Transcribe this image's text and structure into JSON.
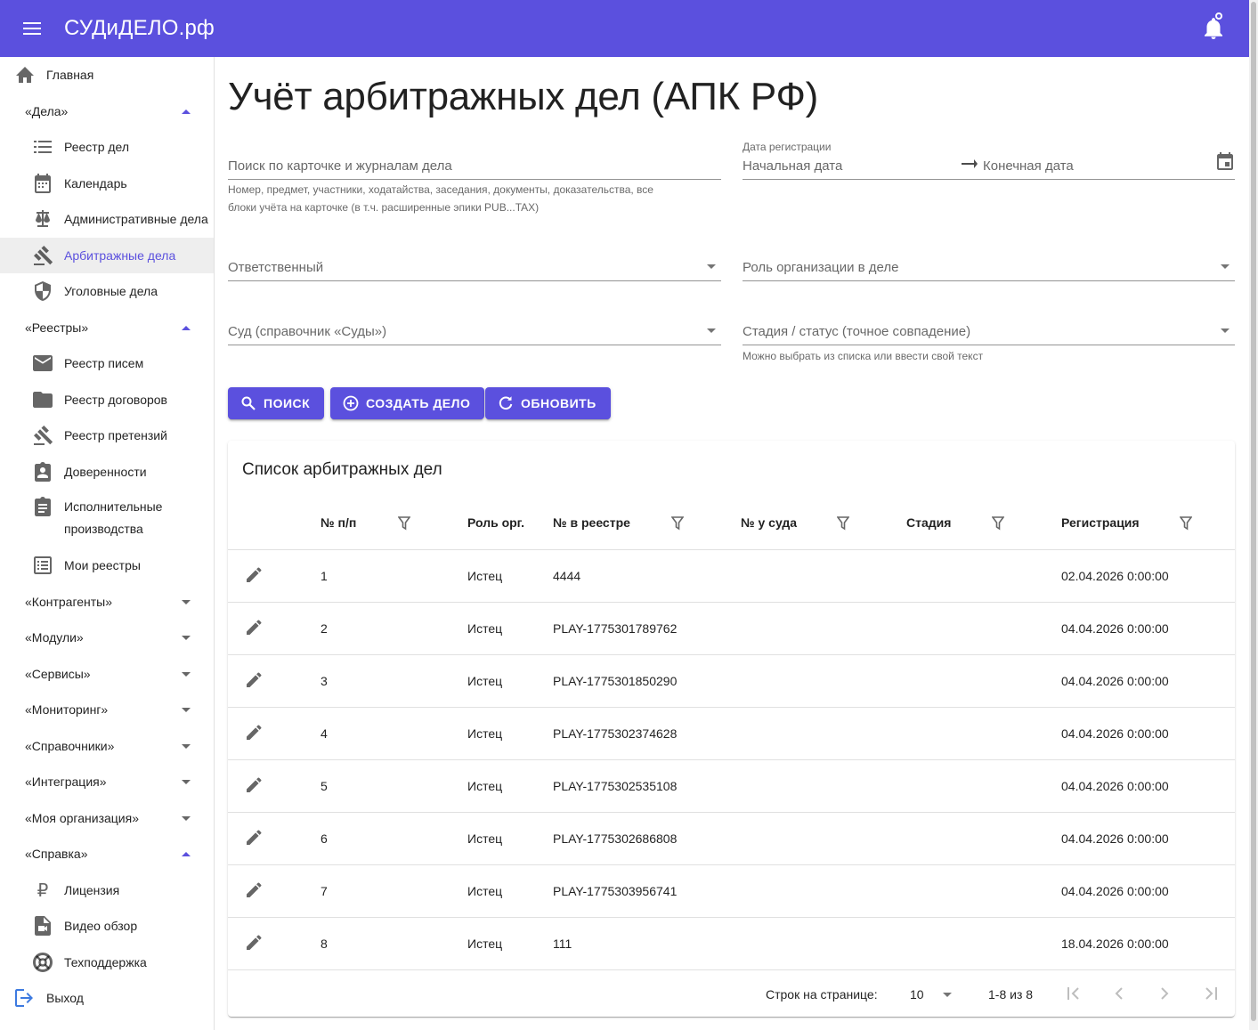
{
  "app": {
    "title": "СУДиДЕЛО.рф"
  },
  "sidebar": {
    "home": "Главная",
    "cases_group": "«Дела»",
    "cases_items": [
      "Реестр дел",
      "Календарь",
      "Административные дела",
      "Арбитражные дела",
      "Уголовные дела"
    ],
    "registries_group": "«Реестры»",
    "registries_items": [
      "Реестр писем",
      "Реестр договоров",
      "Реестр претензий",
      "Доверенности",
      "Исполнительные",
      "производства",
      "Мои реестры"
    ],
    "collapsed_groups": [
      "«Контрагенты»",
      "«Модули»",
      "«Сервисы»",
      "«Мониторинг»",
      "«Справочники»",
      "«Интеграция»",
      "«Моя организация»"
    ],
    "help_group": "«Справка»",
    "help_items": [
      "Лицензия",
      "Видео обзор",
      "Техподдержка"
    ],
    "logout": "Выход",
    "accent": "#5b50de"
  },
  "page": {
    "title": "Учёт арбитражных дел (АПК РФ)"
  },
  "filters": {
    "search_placeholder": "Поиск по карточке и журналам дела",
    "search_hint_1": "Номер, предмет, участники, ходатайства, заседания, документы, доказательства, все",
    "search_hint_2": "блоки учёта на карточке (в т.ч. расширенные эпики PUB...TAX)",
    "date_label": "Дата регистрации",
    "date_start": "Начальная дата",
    "date_end": "Конечная дата",
    "responsible": "Ответственный",
    "org_role": "Роль организации в деле",
    "court": "Суд (справочник «Суды»)",
    "stage": "Стадия / статус (точное совпадение)",
    "stage_hint": "Можно выбрать из списка или ввести свой текст"
  },
  "buttons": {
    "search": "ПОИСК",
    "create": "СОЗДАТЬ ДЕЛО",
    "refresh": "ОБНОВИТЬ"
  },
  "table": {
    "title": "Список арбитражных дел",
    "headers": {
      "num": "№ п/п",
      "role": "Роль орг.",
      "reg_num": "№ в реестре",
      "court_num": "№ у суда",
      "stage": "Стадия",
      "registered": "Регистрация"
    },
    "rows": [
      {
        "num": "1",
        "role": "Истец",
        "reg_num": "4444",
        "court_num": "",
        "stage": "",
        "registered": "02.04.2026 0:00:00"
      },
      {
        "num": "2",
        "role": "Истец",
        "reg_num": "PLAY-1775301789762",
        "court_num": "",
        "stage": "",
        "registered": "04.04.2026 0:00:00"
      },
      {
        "num": "3",
        "role": "Истец",
        "reg_num": "PLAY-1775301850290",
        "court_num": "",
        "stage": "",
        "registered": "04.04.2026 0:00:00"
      },
      {
        "num": "4",
        "role": "Истец",
        "reg_num": "PLAY-1775302374628",
        "court_num": "",
        "stage": "",
        "registered": "04.04.2026 0:00:00"
      },
      {
        "num": "5",
        "role": "Истец",
        "reg_num": "PLAY-1775302535108",
        "court_num": "",
        "stage": "",
        "registered": "04.04.2026 0:00:00"
      },
      {
        "num": "6",
        "role": "Истец",
        "reg_num": "PLAY-1775302686808",
        "court_num": "",
        "stage": "",
        "registered": "04.04.2026 0:00:00"
      },
      {
        "num": "7",
        "role": "Истец",
        "reg_num": "PLAY-1775303956741",
        "court_num": "",
        "stage": "",
        "registered": "04.04.2026 0:00:00"
      },
      {
        "num": "8",
        "role": "Истец",
        "reg_num": "111",
        "court_num": "",
        "stage": "",
        "registered": "18.04.2026 0:00:00"
      }
    ],
    "footer": {
      "rows_per_page_label": "Строк на странице:",
      "rows_per_page": "10",
      "range": "1-8 из 8"
    }
  }
}
